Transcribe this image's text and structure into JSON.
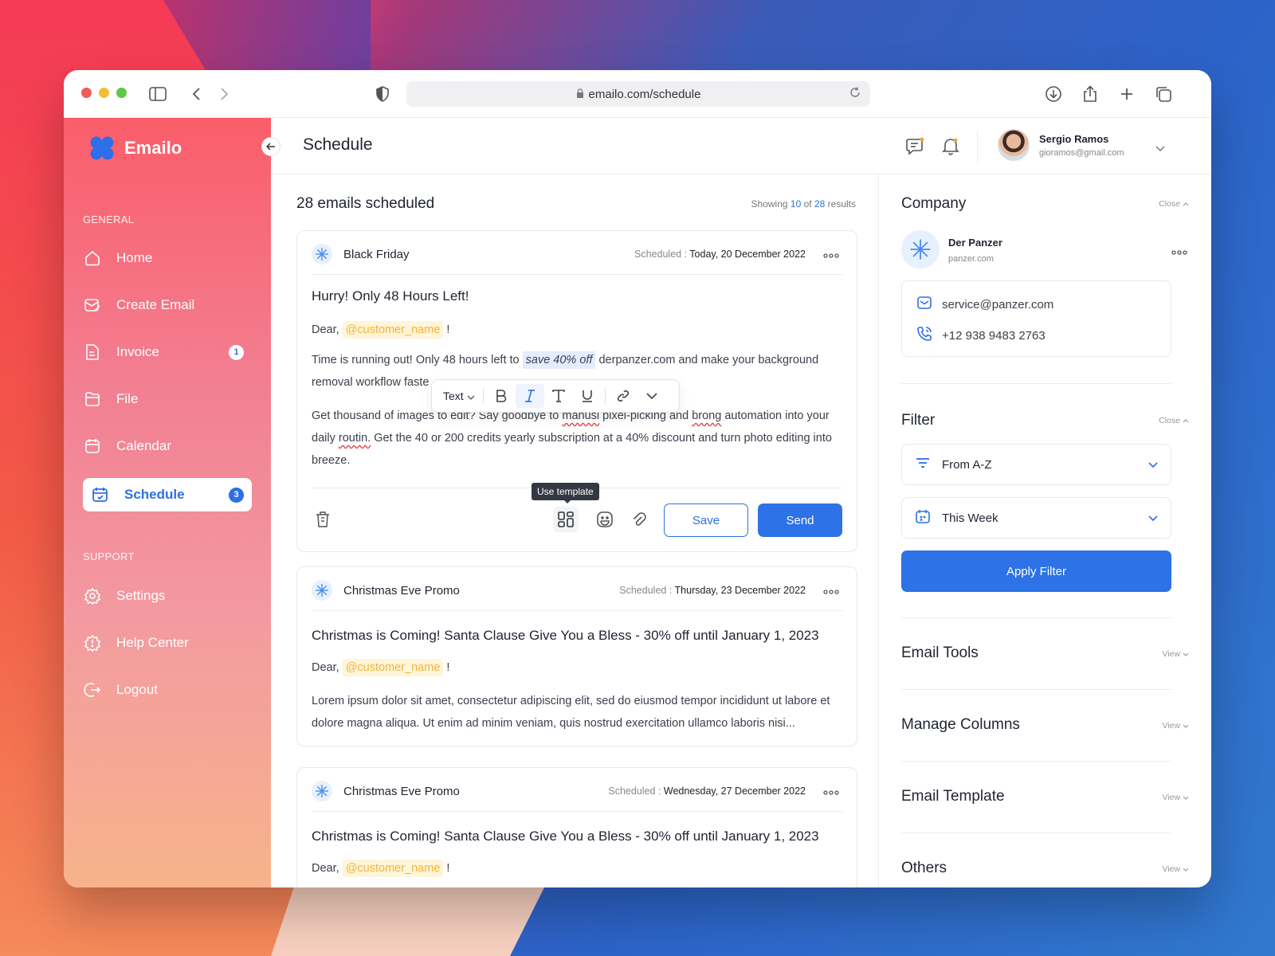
{
  "browser": {
    "url": "emailo.com/schedule"
  },
  "app": {
    "name": "Emailo"
  },
  "sidebar": {
    "general_label": "GENERAL",
    "support_label": "SUPPORT",
    "items": [
      {
        "label": "Home"
      },
      {
        "label": "Create Email"
      },
      {
        "label": "Invoice",
        "badge": "1"
      },
      {
        "label": "File"
      },
      {
        "label": "Calendar"
      },
      {
        "label": "Schedule",
        "badge": "3"
      }
    ],
    "support_items": [
      {
        "label": "Settings"
      },
      {
        "label": "Help Center"
      },
      {
        "label": "Logout"
      }
    ]
  },
  "header": {
    "title": "Schedule"
  },
  "user": {
    "name": "Sergio Ramos",
    "email": "gioramos@gmail.com"
  },
  "feed": {
    "title": "28 emails scheduled",
    "showing_prefix": "Showing",
    "showing_count": "10",
    "showing_of": "of",
    "showing_total": "28",
    "showing_suffix": "results"
  },
  "emails": [
    {
      "name": "Black Friday",
      "sched_label": "Scheduled :",
      "date": "Today, 20 December 2022",
      "subject": "Hurry! Only 48 Hours Left!",
      "greeting": "Dear,",
      "tag": "@customer_name",
      "greeting_end": "!",
      "p1_a": "Time is running out! Only 48 hours left to",
      "p1_hl": "save 40% off",
      "p1_b": "derpanzer.com and make your background removal workflow faste",
      "p2_a": "Get thousand of images to edit? Say goodbye to",
      "p2_w1": "manusl",
      "p2_b": "pixel-picking and",
      "p2_w2": "brong",
      "p2_c": "automation into your daily",
      "p2_w3": "routin.",
      "p2_d": "Get the 40 or 200 credits yearly subscription at a 40% discount and turn photo editing into breeze."
    },
    {
      "name": "Christmas Eve Promo",
      "sched_label": "Scheduled :",
      "date": "Thursday, 23 December 2022",
      "subject": "Christmas is Coming! Santa Clause Give You a Bless - 30% off until January 1, 2023",
      "greeting": "Dear,",
      "tag": "@customer_name",
      "greeting_end": "!",
      "body": "Lorem ipsum dolor sit amet, consectetur adipiscing elit, sed do eiusmod tempor incididunt ut labore et dolore magna aliqua. Ut enim ad minim veniam, quis nostrud exercitation ullamco laboris nisi..."
    },
    {
      "name": "Christmas Eve Promo",
      "sched_label": "Scheduled :",
      "date": "Wednesday, 27 December 2022",
      "subject": "Christmas is Coming! Santa Clause Give You a Bless - 30% off until January 1, 2023",
      "greeting": "Dear,",
      "tag": "@customer_name",
      "greeting_end": "!"
    }
  ],
  "editor": {
    "text_style": "Text",
    "tooltip": "Use template",
    "save_label": "Save",
    "send_label": "Send"
  },
  "company": {
    "title": "Company",
    "close_label": "Close",
    "name": "Der Panzer",
    "domain": "panzer.com",
    "email": "service@panzer.com",
    "phone": "+12 938 9483 2763"
  },
  "filter": {
    "title": "Filter",
    "close_label": "Close",
    "sort": "From A-Z",
    "period": "This Week",
    "apply_label": "Apply Filter"
  },
  "panels": [
    {
      "title": "Email Tools",
      "link": "View"
    },
    {
      "title": "Manage Columns",
      "link": "View"
    },
    {
      "title": "Email Template",
      "link": "View"
    },
    {
      "title": "Others",
      "link": "View"
    }
  ],
  "colors": {
    "accent": "#2d72e6",
    "tag_bg": "#fff5d9",
    "tag_text": "#f1b53c"
  }
}
